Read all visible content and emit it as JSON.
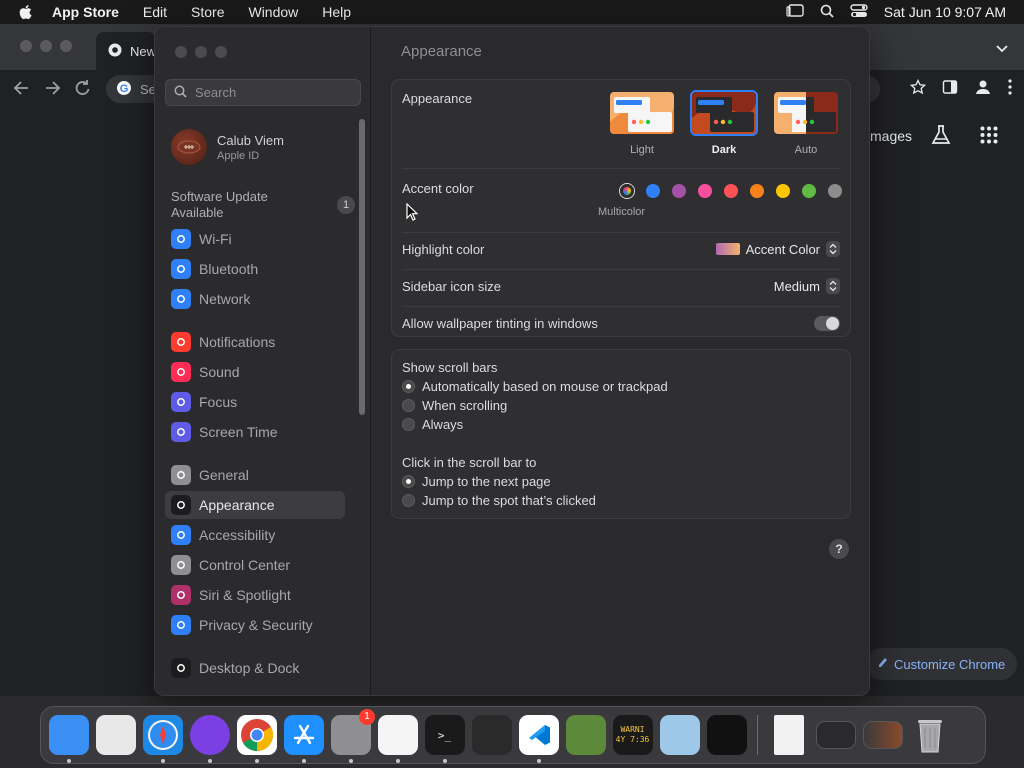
{
  "menubar": {
    "app_name": "App Store",
    "items": [
      "Edit",
      "Store",
      "Window",
      "Help"
    ],
    "datetime": "Sat Jun 10  9:07 AM"
  },
  "chrome": {
    "tab_title": "New",
    "omnibox_text": "Se",
    "images_link": "mages",
    "customize_label": "Customize Chrome"
  },
  "settings": {
    "search_placeholder": "Search",
    "profile": {
      "name": "Calub Viem",
      "subtitle": "Apple ID"
    },
    "update": {
      "label": "Software Update Available",
      "count": "1"
    },
    "sidebar": [
      {
        "label": "Wi-Fi",
        "icon": "wifi-icon",
        "color": "#2f7ff7"
      },
      {
        "label": "Bluetooth",
        "icon": "bluetooth-icon",
        "color": "#2f7ff7"
      },
      {
        "label": "Network",
        "icon": "globe-icon",
        "color": "#2f7ff7"
      },
      {
        "label": "Notifications",
        "icon": "bell-icon",
        "color": "#ff3b30"
      },
      {
        "label": "Sound",
        "icon": "speaker-icon",
        "color": "#ff2d55"
      },
      {
        "label": "Focus",
        "icon": "moon-icon",
        "color": "#5e5ce6"
      },
      {
        "label": "Screen Time",
        "icon": "hourglass-icon",
        "color": "#5e5ce6"
      },
      {
        "label": "General",
        "icon": "gear-icon",
        "color": "#8e8e93"
      },
      {
        "label": "Appearance",
        "icon": "appearance-icon",
        "color": "#1c1c1e"
      },
      {
        "label": "Accessibility",
        "icon": "accessibility-icon",
        "color": "#2f7ff7"
      },
      {
        "label": "Control Center",
        "icon": "control-center-icon",
        "color": "#8e8e93"
      },
      {
        "label": "Siri & Spotlight",
        "icon": "siri-icon",
        "color": "#b0306a"
      },
      {
        "label": "Privacy & Security",
        "icon": "hand-icon",
        "color": "#2f7ff7"
      },
      {
        "label": "Desktop & Dock",
        "icon": "dock-icon",
        "color": "#1c1c1e"
      }
    ],
    "selected_item": "Appearance",
    "page_title": "Appearance",
    "appearance": {
      "label": "Appearance",
      "options": [
        "Light",
        "Dark",
        "Auto"
      ],
      "selected": "Dark"
    },
    "accent": {
      "label": "Accent color",
      "caption": "Multicolor",
      "colors": [
        "#2f7ff7",
        "#a550a7",
        "#f74f9e",
        "#ff5257",
        "#f7821b",
        "#ffc600",
        "#62ba46",
        "#8c8c8c"
      ]
    },
    "highlight": {
      "label": "Highlight color",
      "value": "Accent Color"
    },
    "icon_size": {
      "label": "Sidebar icon size",
      "value": "Medium"
    },
    "tinting": {
      "label": "Allow wallpaper tinting in windows",
      "on": true
    },
    "scroll_bars": {
      "label": "Show scroll bars",
      "options": [
        "Automatically based on mouse or trackpad",
        "When scrolling",
        "Always"
      ],
      "selected": 0
    },
    "click_scroll": {
      "label": "Click in the scroll bar to",
      "options": [
        "Jump to the next page",
        "Jump to the spot that’s clicked"
      ],
      "selected": 0
    },
    "help": "?"
  },
  "dock": {
    "items": [
      {
        "name": "finder",
        "color": "#3a8ff5",
        "running": true
      },
      {
        "name": "launchpad",
        "color": "#e8e8e8",
        "running": false
      },
      {
        "name": "safari",
        "color": "#1e88e5",
        "running": true
      },
      {
        "name": "firefox",
        "color": "#7b3fe4",
        "running": true
      },
      {
        "name": "chrome",
        "color": "#ffffff",
        "running": true
      },
      {
        "name": "app-store",
        "color": "#1e90ff",
        "running": true
      },
      {
        "name": "system-settings",
        "color": "#8e8e93",
        "running": true,
        "badge": "1"
      },
      {
        "name": "textedit",
        "color": "#f5f5f5",
        "running": true
      },
      {
        "name": "terminal",
        "color": "#1a1a1a",
        "running": true
      },
      {
        "name": "garageband",
        "color": "#2a2a2a",
        "running": false
      },
      {
        "name": "vscode",
        "color": "#ffffff",
        "running": true
      },
      {
        "name": "minecraft",
        "color": "#5d8a3a",
        "running": false
      },
      {
        "name": "console",
        "color": "#1a1a1a",
        "running": false,
        "text": "WARNI\n4Y 7:36"
      },
      {
        "name": "quicktime",
        "color": "#9ec8e8",
        "running": false
      },
      {
        "name": "stage",
        "color": "#111111",
        "running": false
      }
    ],
    "recent": [
      "document",
      "window-preview-1",
      "window-preview-2",
      "trash"
    ]
  }
}
